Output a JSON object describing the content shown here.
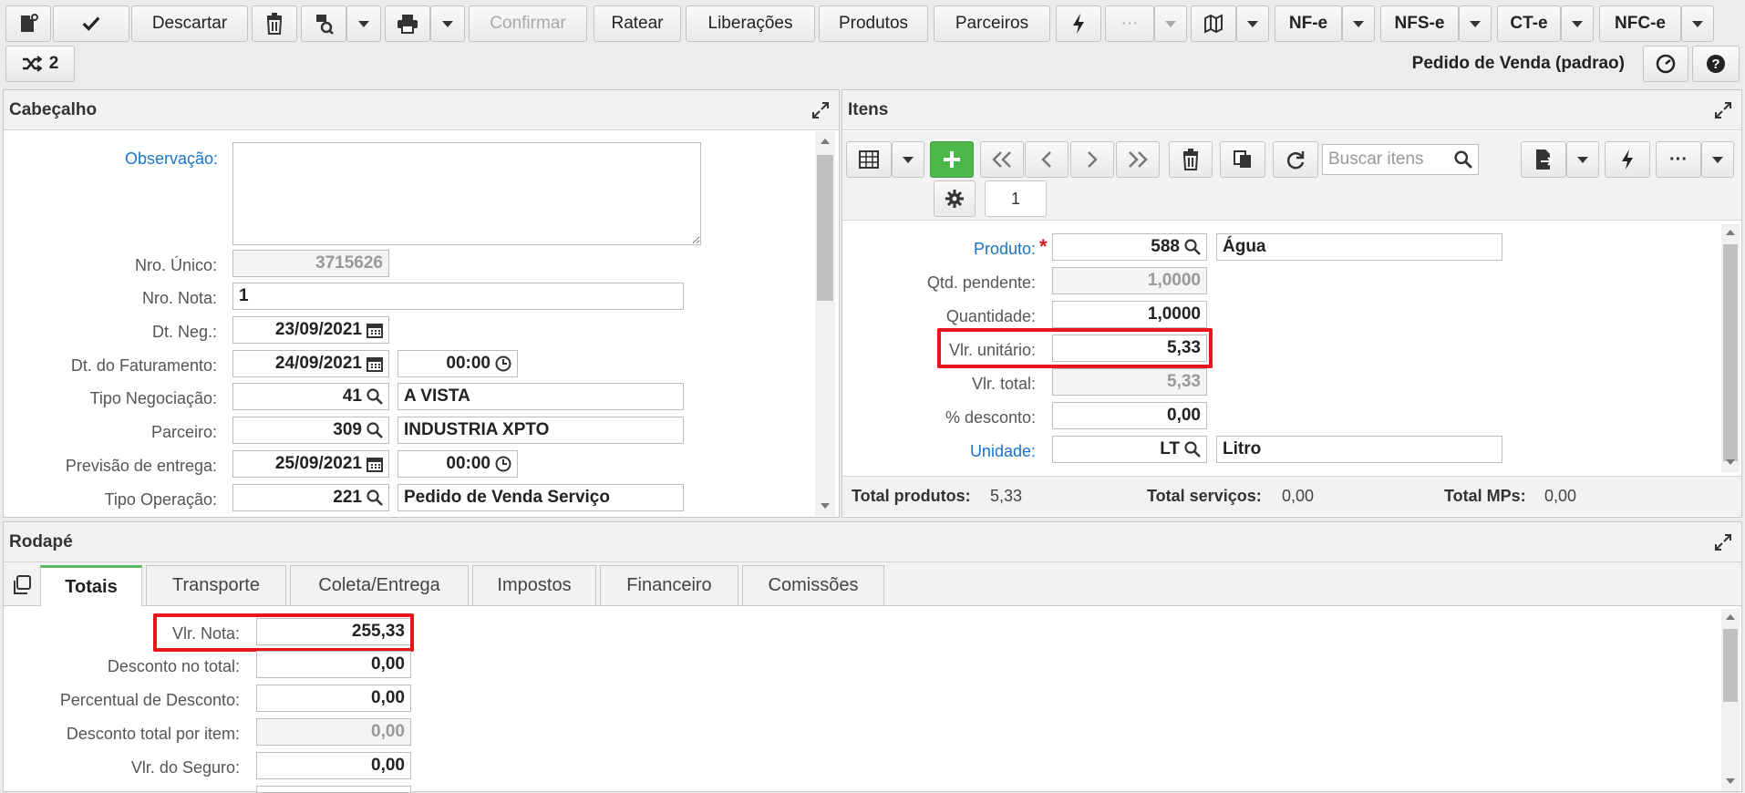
{
  "toolbar": {
    "discard_label": "Descartar",
    "confirm_label": "Confirmar",
    "ratear_label": "Ratear",
    "liberacoes_label": "Liberações",
    "produtos_label": "Produtos",
    "parceiros_label": "Parceiros",
    "ellipsis_label": "···",
    "nfe_label": "NF-e",
    "nfse_label": "NFS-e",
    "cte_label": "CT-e",
    "nfce_label": "NFC-e",
    "shuffle_count": "2",
    "layout_name": "Pedido de Venda (padrao)"
  },
  "header_panel": {
    "title": "Cabeçalho",
    "fields": {
      "observacao_label": "Observação:",
      "observacao_value": "",
      "nro_unico_label": "Nro. Único:",
      "nro_unico_value": "3715626",
      "nro_nota_label": "Nro. Nota:",
      "nro_nota_value": "1",
      "dt_neg_label": "Dt. Neg.:",
      "dt_neg_value": "23/09/2021",
      "dt_fat_label": "Dt. do Faturamento:",
      "dt_fat_value": "24/09/2021",
      "dt_fat_time": "00:00",
      "tipo_neg_label": "Tipo Negociação:",
      "tipo_neg_code": "41",
      "tipo_neg_desc": "A VISTA",
      "parceiro_label": "Parceiro:",
      "parceiro_code": "309",
      "parceiro_desc": "INDUSTRIA XPTO",
      "prev_entrega_label": "Previsão de entrega:",
      "prev_entrega_value": "25/09/2021",
      "prev_entrega_time": "00:00",
      "tipo_op_label": "Tipo Operação:",
      "tipo_op_code": "221",
      "tipo_op_desc": "Pedido de Venda Serviço"
    }
  },
  "items_panel": {
    "title": "Itens",
    "search_placeholder": "Buscar itens",
    "page_tab": "1",
    "fields": {
      "produto_label": "Produto:",
      "produto_required": "*",
      "produto_code": "588",
      "produto_desc": "Água",
      "qtd_pend_label": "Qtd. pendente:",
      "qtd_pend_value": "1,0000",
      "quantidade_label": "Quantidade:",
      "quantidade_value": "1,0000",
      "vlr_unit_label": "Vlr. unitário:",
      "vlr_unit_value": "5,33",
      "vlr_total_label": "Vlr. total:",
      "vlr_total_value": "5,33",
      "desconto_label": "% desconto:",
      "desconto_value": "0,00",
      "unidade_label": "Unidade:",
      "unidade_code": "LT",
      "unidade_desc": "Litro"
    },
    "totals": {
      "produtos_label": "Total produtos:",
      "produtos_value": "5,33",
      "servicos_label": "Total serviços:",
      "servicos_value": "0,00",
      "mps_label": "Total MPs:",
      "mps_value": "0,00"
    }
  },
  "footer_panel": {
    "title": "Rodapé",
    "tabs": [
      "Totais",
      "Transporte",
      "Coleta/Entrega",
      "Impostos",
      "Financeiro",
      "Comissões"
    ],
    "fields": {
      "vlr_nota_label": "Vlr. Nota:",
      "vlr_nota_value": "255,33",
      "desc_total_label": "Desconto no total:",
      "desc_total_value": "0,00",
      "perc_desc_label": "Percentual de Desconto:",
      "perc_desc_value": "0,00",
      "desc_item_label": "Desconto total por item:",
      "desc_item_value": "0,00",
      "vlr_seguro_label": "Vlr. do Seguro:",
      "vlr_seguro_value": "0,00"
    }
  },
  "colors": {
    "highlight": "#e8141a",
    "add_button": "#4cb84a",
    "link": "#1a73c9",
    "active_tab": "#5cb85c"
  }
}
